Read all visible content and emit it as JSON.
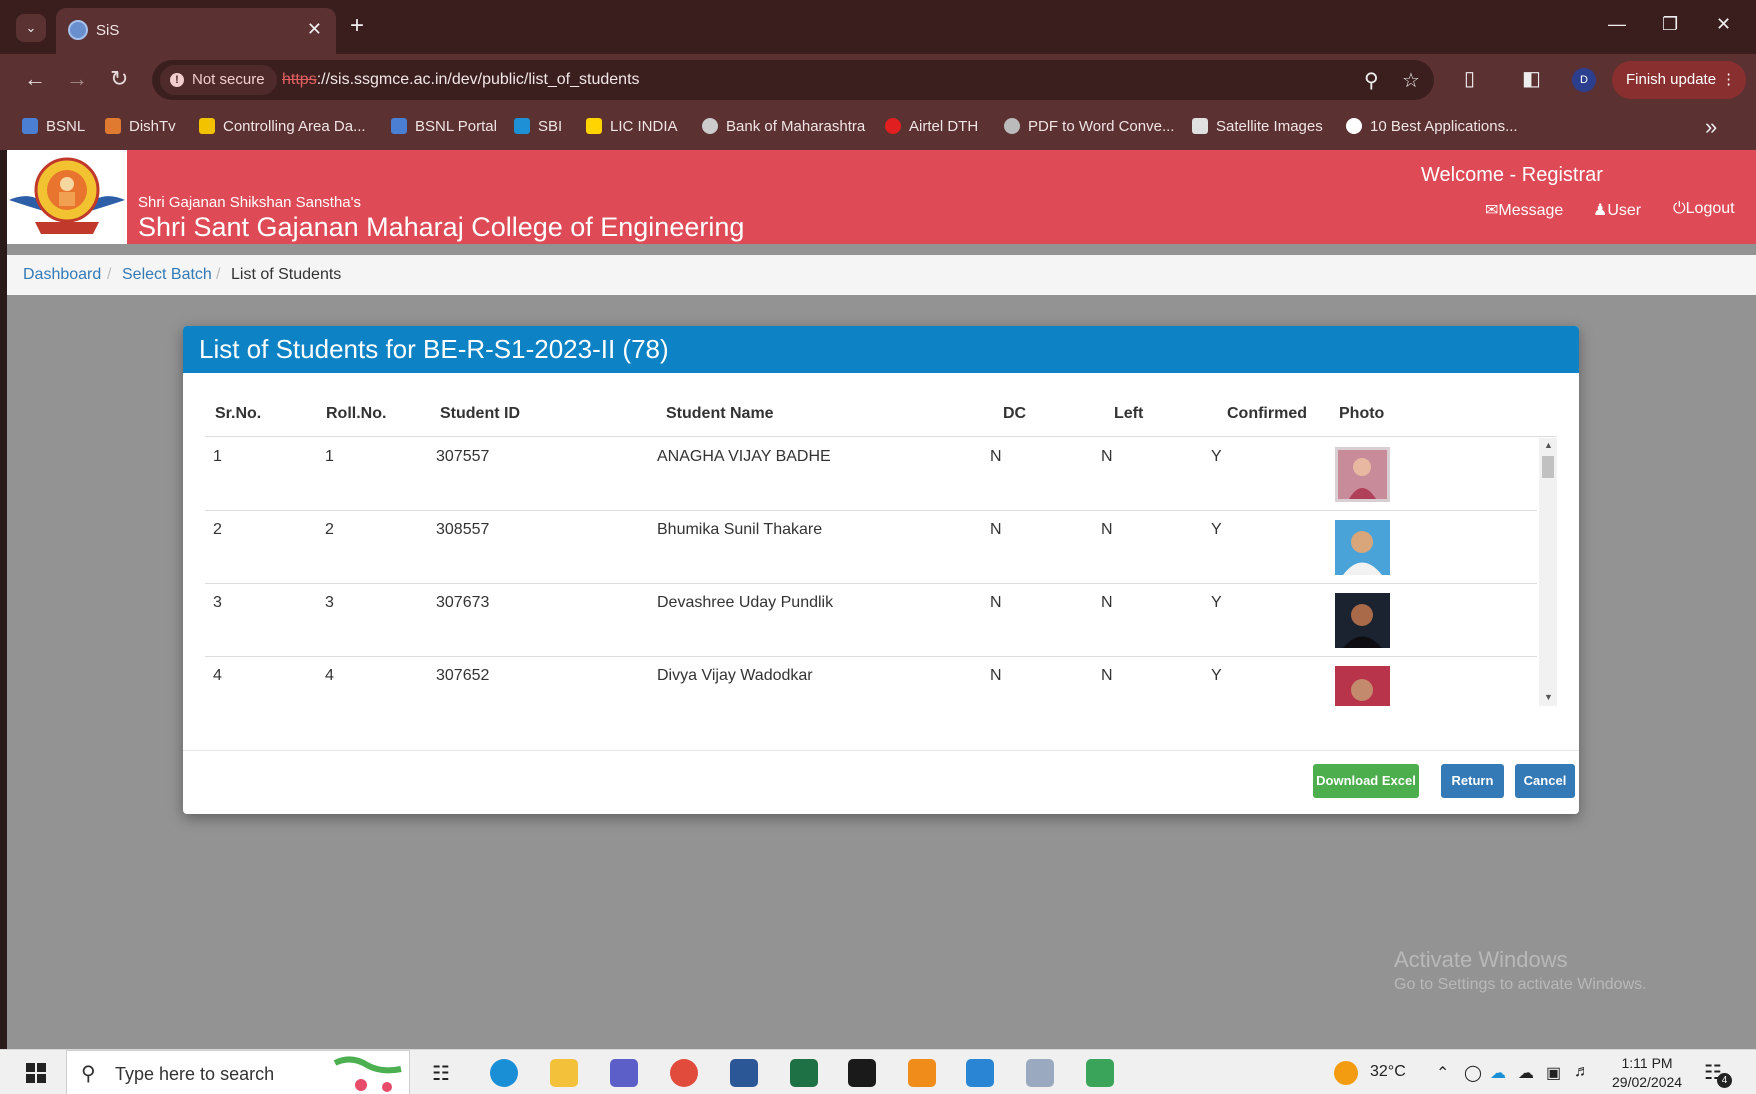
{
  "browser": {
    "tab_title": "SiS",
    "new_tab": "+",
    "address": {
      "security_label": "Not secure",
      "url_scheme": "https",
      "url_rest": "://sis.ssgmce.ac.in/dev/public/list_of_students"
    },
    "finish_update_label": "Finish update",
    "profile_initial": "D",
    "bookmarks": [
      {
        "label": "BSNL",
        "color": "#4a7fd4"
      },
      {
        "label": "DishTv",
        "color": "#e07a30"
      },
      {
        "label": "Controlling Area Da...",
        "color": "#f2c200"
      },
      {
        "label": "BSNL Portal",
        "color": "#4a7fd4"
      },
      {
        "label": "SBI",
        "color": "#1e90d6"
      },
      {
        "label": "LIC INDIA",
        "color": "#ffd400"
      },
      {
        "label": "Bank of Maharashtra",
        "color": "#cccccc"
      },
      {
        "label": "Airtel DTH",
        "color": "#e02020"
      },
      {
        "label": "PDF to Word Conve...",
        "color": "#bbbbbb"
      },
      {
        "label": "Satellite Images",
        "color": "#e0e0e0"
      },
      {
        "label": "10 Best Applications...",
        "color": "#ffffff"
      }
    ]
  },
  "header": {
    "org_name": "Shri Gajanan Shikshan Sanstha's",
    "college_name": "Shri Sant Gajanan Maharaj College of Engineering",
    "welcome": "Welcome - Registrar",
    "links": {
      "message": "Message",
      "user": "User",
      "logout": "Logout"
    },
    "accent_color": "#de4a55"
  },
  "breadcrumb": {
    "dashboard": "Dashboard",
    "select_batch": "Select Batch",
    "current": "List of Students",
    "separator": "/"
  },
  "modal": {
    "title": "List of Students for BE-R-S1-2023-II (78)",
    "columns": [
      "Sr.No.",
      "Roll.No.",
      "Student ID",
      "Student Name",
      "DC",
      "Left",
      "Confirmed",
      "Photo"
    ],
    "rows": [
      {
        "sr": "1",
        "roll": "1",
        "id": "307557",
        "name": "ANAGHA VIJAY BADHE",
        "dc": "N",
        "left": "N",
        "confirmed": "Y"
      },
      {
        "sr": "2",
        "roll": "2",
        "id": "308557",
        "name": "Bhumika Sunil Thakare",
        "dc": "N",
        "left": "N",
        "confirmed": "Y"
      },
      {
        "sr": "3",
        "roll": "3",
        "id": "307673",
        "name": "Devashree Uday Pundlik",
        "dc": "N",
        "left": "N",
        "confirmed": "Y"
      },
      {
        "sr": "4",
        "roll": "4",
        "id": "307652",
        "name": "Divya Vijay Wadodkar",
        "dc": "N",
        "left": "N",
        "confirmed": "Y"
      }
    ],
    "buttons": {
      "download_excel": "Download Excel",
      "return": "Return",
      "cancel": "Cancel"
    },
    "header_color": "#0d82c4"
  },
  "watermark": {
    "line1": "Activate Windows",
    "line2": "Go to Settings to activate Windows."
  },
  "taskbar": {
    "search_placeholder": "Type here to search",
    "weather": "32°C",
    "time": "1:11 PM",
    "date": "29/02/2024",
    "notification_count": "4"
  }
}
